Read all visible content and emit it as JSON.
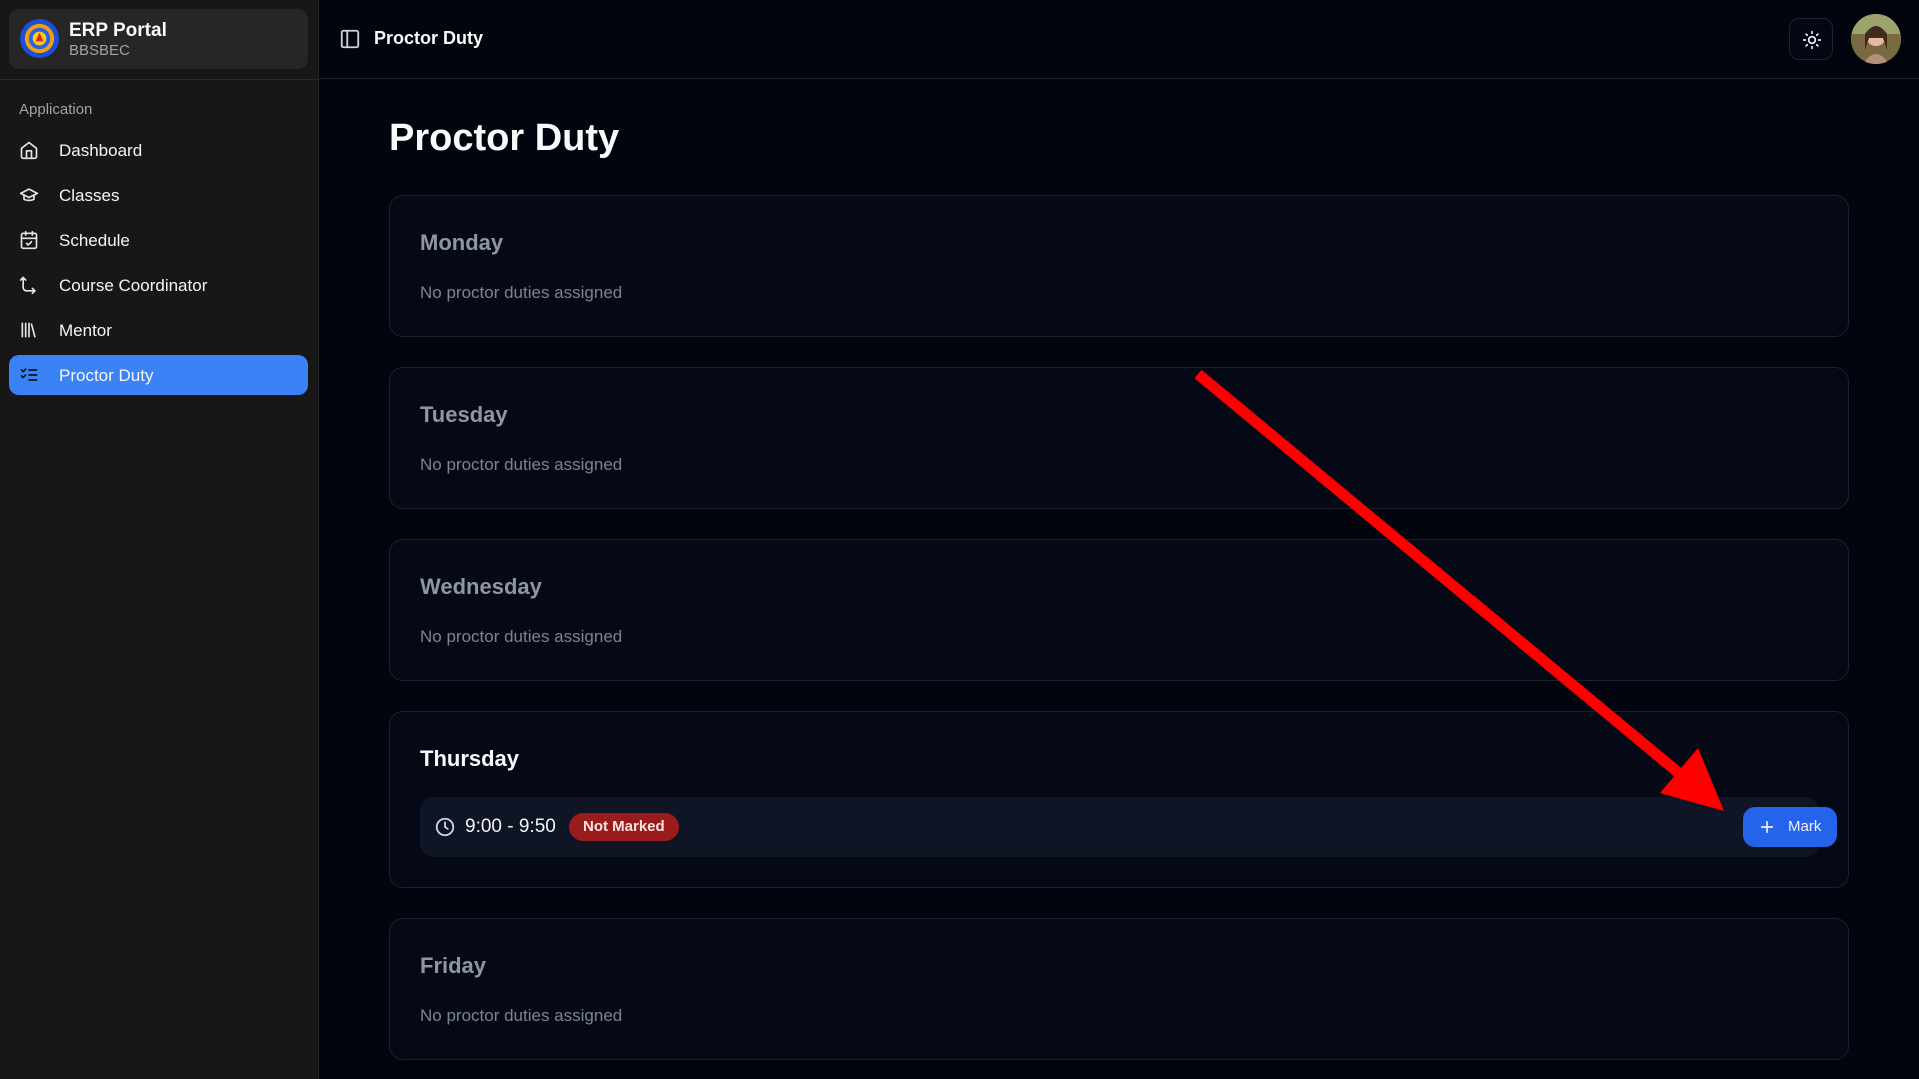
{
  "sidebar": {
    "brand": {
      "title": "ERP Portal",
      "subtitle": "BBSBEC"
    },
    "group_label": "Application",
    "items": [
      {
        "label": "Dashboard",
        "icon": "home-icon"
      },
      {
        "label": "Classes",
        "icon": "graduation-cap-icon"
      },
      {
        "label": "Schedule",
        "icon": "calendar-check-icon"
      },
      {
        "label": "Course Coordinator",
        "icon": "route-icon"
      },
      {
        "label": "Mentor",
        "icon": "library-icon"
      },
      {
        "label": "Proctor Duty",
        "icon": "list-checks-icon",
        "active": true
      }
    ]
  },
  "header": {
    "title": "Proctor Duty",
    "toggle_icon": "sidebar-toggle-icon",
    "theme_icon": "sun-icon"
  },
  "main": {
    "title": "Proctor Duty",
    "days": [
      {
        "name": "Monday",
        "empty_text": "No proctor duties assigned"
      },
      {
        "name": "Tuesday",
        "empty_text": "No proctor duties assigned"
      },
      {
        "name": "Wednesday",
        "empty_text": "No proctor duties assigned"
      },
      {
        "name": "Thursday",
        "duty": {
          "time": "9:00 - 9:50",
          "status": "Not Marked",
          "action_label": "Mark"
        }
      },
      {
        "name": "Friday",
        "empty_text": "No proctor duties assigned"
      }
    ]
  },
  "colors": {
    "accent": "#3b82f6",
    "button": "#2563eb",
    "status_not_marked": "#991b1b",
    "annotation_arrow": "#ff0000"
  }
}
